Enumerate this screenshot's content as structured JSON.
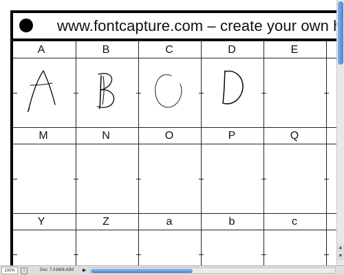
{
  "document": {
    "header_text": "www.fontcapture.com – create your own h",
    "rows": [
      {
        "letters": [
          "A",
          "B",
          "C",
          "D",
          "E"
        ],
        "drawn": [
          "A",
          "B",
          "C",
          "D"
        ]
      },
      {
        "letters": [
          "M",
          "N",
          "O",
          "P",
          "Q"
        ],
        "drawn": []
      },
      {
        "letters": [
          "Y",
          "Z",
          "a",
          "b",
          "c"
        ],
        "drawn": []
      }
    ]
  },
  "statusbar": {
    "zoom": "100%",
    "doc_info": "Doc: 7.01M/8.42M",
    "arrow_glyph": "▶"
  },
  "scrollbars": {
    "vertical": {
      "position": 0.0
    },
    "horizontal": {
      "position": 0.0
    }
  },
  "icons": [
    "black-dot-icon",
    "status-arrow-icon",
    "scroll-up-arrow-icon",
    "scroll-down-arrow-icon"
  ]
}
